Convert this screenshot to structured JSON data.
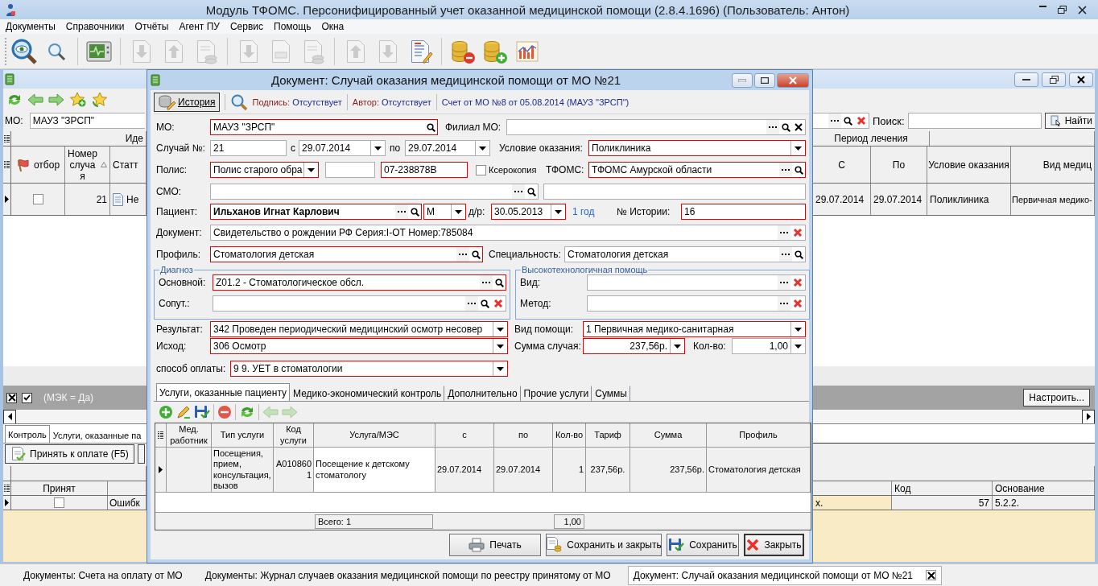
{
  "window": {
    "title": "Модуль ТФОМС. Персонифицированный учет оказанной медицинской помощи (2.8.4.1696) (Пользователь: Антон)"
  },
  "menu": [
    "Документы",
    "Справочники",
    "Отчёты",
    "Агент ПУ",
    "Сервис",
    "Помощь",
    "Окна"
  ],
  "toolbar": [
    [
      {
        "disabled": false
      },
      {
        "disabled": false
      }
    ],
    [
      {
        "disabled": false
      }
    ],
    [
      {
        "disabled": true
      },
      {
        "disabled": true
      },
      {
        "disabled": true
      }
    ],
    [
      {
        "disabled": true
      },
      {
        "disabled": true
      },
      {
        "disabled": true
      }
    ],
    [
      {
        "disabled": true
      },
      {
        "disabled": true
      },
      {
        "disabled": false
      }
    ],
    [
      {
        "disabled": false
      },
      {
        "disabled": false
      },
      {
        "disabled": false
      }
    ]
  ],
  "list_window": {
    "mo": {
      "label": "МО:",
      "value": "МАУЗ \"ЗРСП\""
    },
    "search": {
      "label": "Поиск:"
    },
    "find_button": "Найти",
    "grid": {
      "band_left": "Иде",
      "band_right": "Период лечения",
      "columns_left": [
        "отбор",
        "Номер случая",
        "Статт"
      ],
      "columns_right": [
        "С",
        "По",
        "Условие оказания",
        "Вид медиц"
      ],
      "rows": [
        {
          "selected": true,
          "checked": false,
          "number": "21",
          "status": "Не",
          "from": "29.07.2014",
          "to": "29.07.2014",
          "condition": "Поликлиника",
          "aid": "Первичная медико-"
        }
      ]
    },
    "filter": {
      "checked": true,
      "text": "(МЭК = Да)"
    },
    "configure_button": "Настроить...",
    "tabs": [
      {
        "label": "Контроль",
        "selected": true
      },
      {
        "label": "Услуги, оказанные па",
        "selected": false
      }
    ],
    "accept_button": "Принять к оплате (F5)",
    "control_grid": {
      "columns_left": [
        "Принят"
      ],
      "columns_right": [
        "Код",
        "Основание"
      ],
      "rows": [
        {
          "selected": true,
          "accepted": false,
          "error": "Ошибк",
          "tail": "х.",
          "code": "57",
          "basis": "5.2.2."
        }
      ]
    }
  },
  "dialog": {
    "title": "Документ: Случай оказания медицинской помощи от МО №21",
    "history_button": "История",
    "signature": {
      "label": "Подпись:",
      "value": "Отсутствует"
    },
    "author": {
      "label": "Автор:",
      "value": "Отсутствует"
    },
    "invoice": "Счет от МО №8 от 05.08.2014 (МАУЗ \"ЗРСП\")",
    "mo": {
      "label": "МО:",
      "value": "МАУЗ \"ЗРСП\"",
      "invalid": true
    },
    "branch": {
      "label": "Филиал МО:",
      "invalid": false
    },
    "case_no": {
      "label": "Случай №:",
      "value": "21",
      "invalid": false
    },
    "date_from": {
      "label": "с",
      "value": "29.07.2014",
      "invalid": false
    },
    "date_to": {
      "label": "по",
      "value": "29.07.2014",
      "invalid": false
    },
    "condition": {
      "label": "Условие оказания:",
      "value": "Поликлиника",
      "invalid": true
    },
    "policy_type": {
      "label": "Полис:",
      "value": "Полис старого обра",
      "invalid": true
    },
    "policy_series": {
      "invalid": false
    },
    "policy_number": {
      "value": "07-238878В",
      "invalid": true
    },
    "photocopy": {
      "label": "Ксерокопия",
      "checked": false
    },
    "tfoms": {
      "label": "ТФОМС:",
      "value": "ТФОМС Амурской области",
      "invalid": true
    },
    "smo": {
      "label": "СМО:",
      "invalid": false
    },
    "smo_extra": {
      "invalid": false
    },
    "patient": {
      "label": "Пациент:",
      "value": "Ильханов Игнат Карлович",
      "invalid": true
    },
    "sex": {
      "value": "М",
      "invalid": true
    },
    "birth": {
      "label": "д/р:",
      "value": "30.05.2013",
      "invalid": true
    },
    "age": "1 год",
    "history_no": {
      "label": "№ Истории:",
      "value": "16",
      "invalid": true
    },
    "document": {
      "label": "Документ:",
      "value": "Свидетельство о рождении РФ Серия:I-ОТ Номер:785084",
      "invalid": false
    },
    "profile": {
      "label": "Профиль:",
      "value": "Стоматология детская",
      "invalid": true
    },
    "specialty": {
      "label": "Специальность:",
      "value": "Стоматология детская",
      "invalid": false
    },
    "diagnosis": {
      "title": "Диагноз",
      "main": {
        "label": "Основной:",
        "value": "Z01.2 - Стоматологическое обсл.",
        "invalid": true
      },
      "secondary": {
        "label": "Сопут.:",
        "invalid": false
      }
    },
    "hightech": {
      "title": "Высокотехнологичная помощь",
      "kind": {
        "label": "Вид:",
        "invalid": false
      },
      "method": {
        "label": "Метод:",
        "invalid": false
      }
    },
    "result": {
      "label": "Результат:",
      "value": "342 Проведен периодический медицинский осмотр несовер",
      "invalid": true
    },
    "aid_type": {
      "label": "Вид помощи:",
      "value": "1 Первичная медико-санитарная",
      "invalid": true
    },
    "outcome": {
      "label": "Исход:",
      "value": "306 Осмотр",
      "invalid": true
    },
    "amount": {
      "label": "Сумма случая:",
      "value": "237,56р.",
      "invalid": true
    },
    "quantity": {
      "label": "Кол-во:",
      "value": "1,00",
      "invalid": false
    },
    "payment": {
      "label": "способ оплаты:",
      "value": "9 9. УЕТ в стоматологии",
      "invalid": true
    },
    "tabs": [
      {
        "label": "Услуги, оказанные пациенту",
        "selected": true
      },
      {
        "label": "Медико-экономический контроль",
        "selected": false
      },
      {
        "label": "Дополнительно",
        "selected": false
      },
      {
        "label": "Прочие услуги",
        "selected": false
      },
      {
        "label": "Суммы",
        "selected": false
      }
    ],
    "services_toolbar": [
      {
        "disabled": false
      },
      {
        "disabled": false
      },
      {
        "disabled": false
      },
      {
        "disabled": false
      },
      {
        "disabled": false
      },
      {
        "disabled": true
      },
      {
        "disabled": true
      }
    ],
    "services": {
      "columns": [
        "Мед. работник",
        "Тип услуги",
        "Код услуги",
        "Услуга/МЭС",
        "с",
        "по",
        "Кол-во",
        "Тариф",
        "Сумма",
        "Профиль"
      ],
      "rows": [
        {
          "selected": true,
          "type": "Посещения, прием, консультация, вызов",
          "code": "A0108601",
          "service": "Посещение к детскому стоматологу",
          "from": "29.07.2014",
          "to": "29.07.2014",
          "qty": "1",
          "tariff": "237,56р.",
          "sum": "237,56р.",
          "profile": "Стоматология детская"
        }
      ],
      "total": "Всего: 1",
      "total_qty": "1,00"
    },
    "buttons": [
      {
        "label": "Печать",
        "focused": false
      },
      {
        "label": "Сохранить и закрыть",
        "focused": false
      },
      {
        "label": "Сохранить",
        "focused": false
      },
      {
        "label": "Закрыть",
        "focused": true
      }
    ]
  },
  "taskbar": [
    {
      "label": "Документы: Счета на оплату от МО",
      "selected": false
    },
    {
      "label": "Документы: Журнал случаев оказания медицинской помощи по реестру принятому от МО",
      "selected": false
    },
    {
      "label": "Документ: Случай оказания медицинской помощи от МО №21",
      "selected": true
    }
  ]
}
